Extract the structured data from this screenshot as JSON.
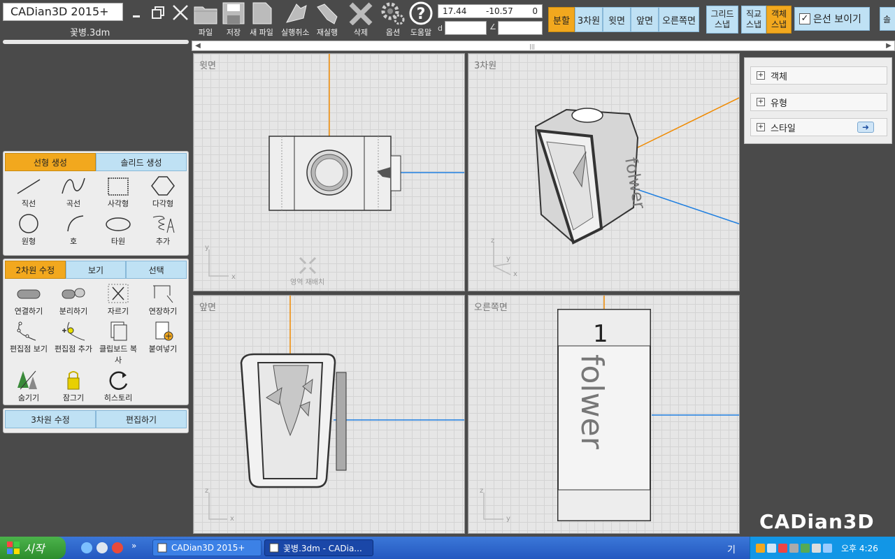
{
  "app": {
    "title": "CADian3D 2015+",
    "filename": "꽃병.3dm",
    "brand": "CADian3D"
  },
  "toolbar": {
    "tools": [
      {
        "label": "파일",
        "icon": "folder-icon"
      },
      {
        "label": "저장",
        "icon": "save-icon"
      },
      {
        "label": "새 파일",
        "icon": "new-file-icon"
      },
      {
        "label": "실행취소",
        "icon": "undo-icon"
      },
      {
        "label": "재실행",
        "icon": "redo-icon"
      },
      {
        "label": "삭제",
        "icon": "delete-icon"
      },
      {
        "label": "옵션",
        "icon": "gear-icon"
      },
      {
        "label": "도움말",
        "icon": "help-icon"
      }
    ],
    "coords": {
      "x": "17.44",
      "y": "-10.57",
      "z": "0"
    },
    "distance_symbol": "d",
    "angle_symbol": "∠",
    "distance_value": "",
    "angle_value": ""
  },
  "view_buttons": [
    {
      "label": "분할",
      "active": true
    },
    {
      "label": "3차원",
      "active": false
    },
    {
      "label": "윗면",
      "active": false
    },
    {
      "label": "앞면",
      "active": false
    },
    {
      "label": "오른쪽면",
      "active": false
    }
  ],
  "snaps": [
    {
      "line1": "그리드",
      "line2": "스냅",
      "active": false
    },
    {
      "line1": "직교",
      "line2": "스냅",
      "active": false
    },
    {
      "line1": "객체",
      "line2": "스냅",
      "active": true
    }
  ],
  "hidden_lines_label": "은선 보이기",
  "overflow_label": "솔",
  "viewports": {
    "top": {
      "title": "윗면",
      "axis1": "y",
      "axis2": "x",
      "rearrange": "영역 재배치"
    },
    "persp": {
      "title": "3차원",
      "axis1": "z",
      "axis2": "y",
      "axis3": "x"
    },
    "front": {
      "title": "앞면",
      "axis1": "z",
      "axis2": "x"
    },
    "right": {
      "title": "오른쪽면",
      "axis1": "z",
      "axis2": "y"
    }
  },
  "panel_create": {
    "tabs": [
      {
        "label": "선형 생성",
        "active": true
      },
      {
        "label": "솔리드 생성",
        "active": false
      }
    ],
    "items": [
      {
        "label": "직선",
        "icon": "line-icon"
      },
      {
        "label": "곡선",
        "icon": "curve-icon"
      },
      {
        "label": "사각형",
        "icon": "rectangle-icon"
      },
      {
        "label": "다각형",
        "icon": "polygon-icon"
      },
      {
        "label": "원형",
        "icon": "circle-icon"
      },
      {
        "label": "호",
        "icon": "arc-icon"
      },
      {
        "label": "타원",
        "icon": "ellipse-icon"
      },
      {
        "label": "추가",
        "icon": "more-icon"
      }
    ]
  },
  "panel_edit2d": {
    "tabs": [
      {
        "label": "2차원 수정",
        "active": true
      },
      {
        "label": "보기",
        "active": false
      },
      {
        "label": "선택",
        "active": false
      }
    ],
    "items": [
      {
        "label": "연결하기",
        "icon": "join-icon"
      },
      {
        "label": "분리하기",
        "icon": "explode-icon"
      },
      {
        "label": "자르기",
        "icon": "trim-icon"
      },
      {
        "label": "연장하기",
        "icon": "extend-icon"
      },
      {
        "label": "편집점 보기",
        "icon": "show-points-icon"
      },
      {
        "label": "편집점 추가",
        "icon": "add-point-icon"
      },
      {
        "label": "클립보드 복사",
        "icon": "copy-icon"
      },
      {
        "label": "붙여넣기",
        "icon": "paste-icon"
      },
      {
        "label": "숨기기",
        "icon": "hide-icon"
      },
      {
        "label": "잠그기",
        "icon": "lock-icon"
      },
      {
        "label": "히스토리",
        "icon": "history-icon"
      }
    ]
  },
  "panel_edit3d": {
    "tabs": [
      {
        "label": "3차원 수정",
        "active": false
      },
      {
        "label": "편집하기",
        "active": false
      }
    ]
  },
  "right_panel": {
    "rows": [
      {
        "label": "객체"
      },
      {
        "label": "유형"
      },
      {
        "label": "스타일"
      }
    ]
  },
  "vase_text": "folwer",
  "vase_number": "1",
  "taskbar": {
    "start_label": "시작",
    "tasks": [
      {
        "label": "CADian3D 2015+",
        "active": false
      },
      {
        "label": "꽃병.3dm - CADia...",
        "active": true
      }
    ],
    "ime": "기",
    "clock": "오후 4:26"
  },
  "colors": {
    "accent": "#f2a81e",
    "tab": "#bfe1f4",
    "axis_x": "#f08a00",
    "axis_y": "#1f7fe0"
  }
}
